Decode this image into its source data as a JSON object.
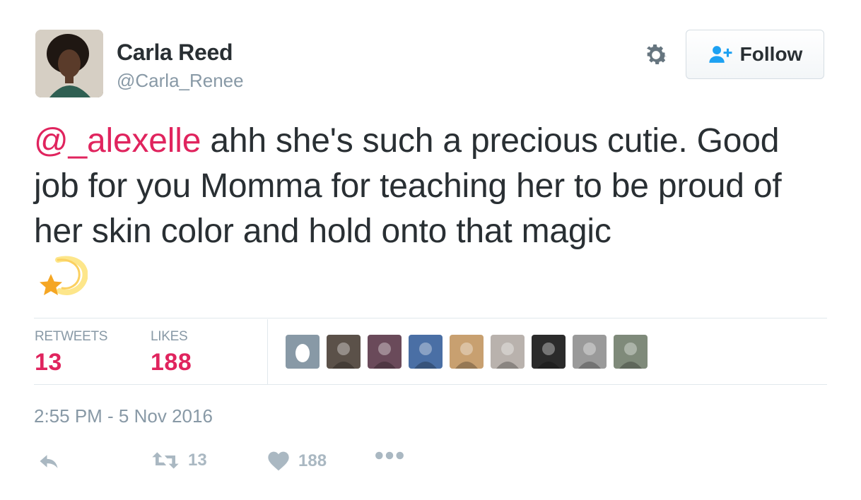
{
  "user": {
    "name": "Carla Reed",
    "handle": "@Carla_Renee"
  },
  "follow_button": {
    "label": "Follow"
  },
  "tweet": {
    "mention": "@_alexelle",
    "text": " ahh she's such a precious cutie. Good job for you Momma for teaching her to be proud of her skin color and hold onto that magic",
    "emoji": "dizzy-star-emoji"
  },
  "stats": {
    "retweets_label": "RETWEETS",
    "retweets_value": "13",
    "likes_label": "LIKES",
    "likes_value": "188"
  },
  "likers": [
    {
      "name": "liker-1",
      "bg": "#8899a6",
      "kind": "egg"
    },
    {
      "name": "liker-2",
      "bg": "#5b5149"
    },
    {
      "name": "liker-3",
      "bg": "#6a4a5a"
    },
    {
      "name": "liker-4",
      "bg": "#4a6fa5"
    },
    {
      "name": "liker-5",
      "bg": "#c8a070"
    },
    {
      "name": "liker-6",
      "bg": "#b9b2ad"
    },
    {
      "name": "liker-7",
      "bg": "#2b2b2b"
    },
    {
      "name": "liker-8",
      "bg": "#9a9a9a"
    },
    {
      "name": "liker-9",
      "bg": "#7f8a7a"
    }
  ],
  "timestamp": "2:55 PM - 5 Nov 2016",
  "actions": {
    "reply_icon": "reply-icon",
    "retweet_count": "13",
    "like_count": "188",
    "more_icon": "more-icon"
  },
  "colors": {
    "accent": "#e0245e",
    "muted": "#8899a6",
    "follow_icon": "#1da1f2"
  }
}
